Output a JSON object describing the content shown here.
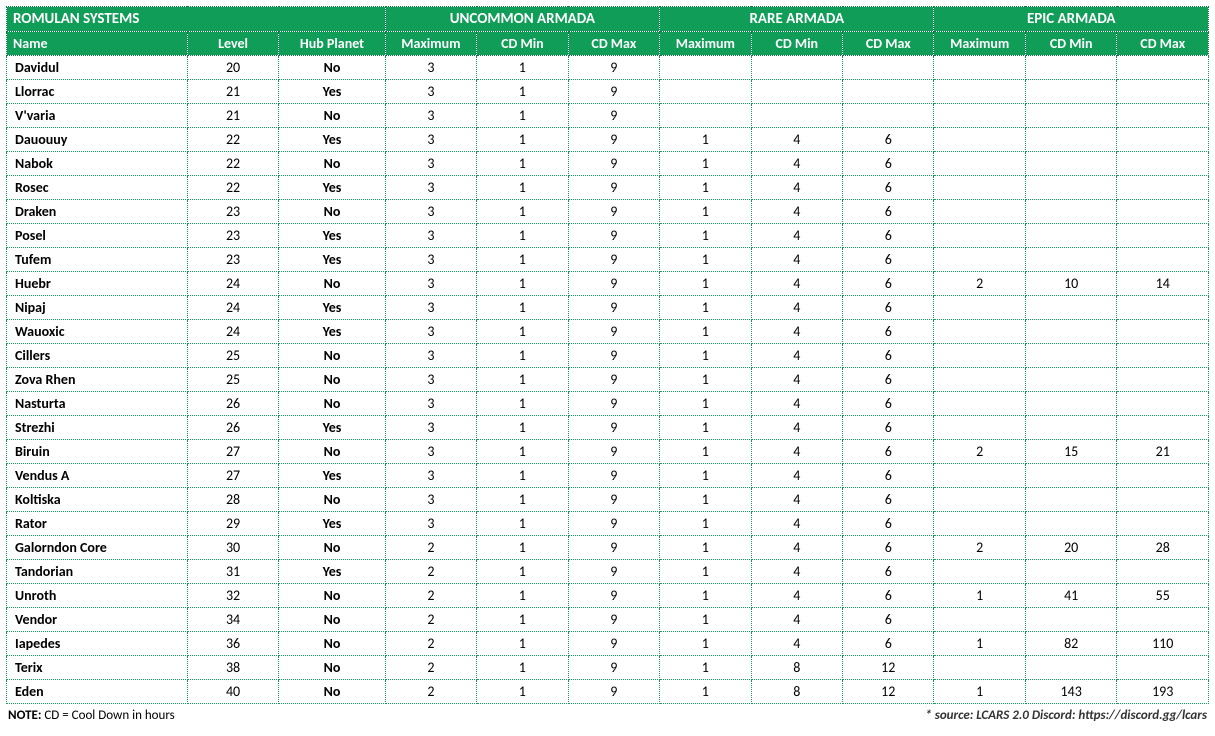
{
  "header": {
    "section_title": "ROMULAN SYSTEMS",
    "groups": [
      "UNCOMMON ARMADA",
      "RARE ARMADA",
      "EPIC ARMADA"
    ],
    "cols": {
      "name": "Name",
      "level": "Level",
      "hub": "Hub Planet",
      "max": "Maximum",
      "cdmin": "CD Min",
      "cdmax": "CD Max"
    }
  },
  "chart_data": {
    "type": "table",
    "title": "ROMULAN SYSTEMS",
    "columns": [
      "Name",
      "Level",
      "Hub Planet",
      "Uncommon Maximum",
      "Uncommon CD Min",
      "Uncommon CD Max",
      "Rare Maximum",
      "Rare CD Min",
      "Rare CD Max",
      "Epic Maximum",
      "Epic CD Min",
      "Epic CD Max"
    ],
    "rows": [
      {
        "name": "Davidul",
        "level": 20,
        "hub": "No",
        "u_max": 3,
        "u_min": 1,
        "u_cdmax": 9,
        "r_max": "",
        "r_min": "",
        "r_cdmax": "",
        "e_max": "",
        "e_min": "",
        "e_cdmax": ""
      },
      {
        "name": "Llorrac",
        "level": 21,
        "hub": "Yes",
        "u_max": 3,
        "u_min": 1,
        "u_cdmax": 9,
        "r_max": "",
        "r_min": "",
        "r_cdmax": "",
        "e_max": "",
        "e_min": "",
        "e_cdmax": ""
      },
      {
        "name": "V'varia",
        "level": 21,
        "hub": "No",
        "u_max": 3,
        "u_min": 1,
        "u_cdmax": 9,
        "r_max": "",
        "r_min": "",
        "r_cdmax": "",
        "e_max": "",
        "e_min": "",
        "e_cdmax": ""
      },
      {
        "name": "Dauouuy",
        "level": 22,
        "hub": "Yes",
        "u_max": 3,
        "u_min": 1,
        "u_cdmax": 9,
        "r_max": 1,
        "r_min": 4,
        "r_cdmax": 6,
        "e_max": "",
        "e_min": "",
        "e_cdmax": ""
      },
      {
        "name": "Nabok",
        "level": 22,
        "hub": "No",
        "u_max": 3,
        "u_min": 1,
        "u_cdmax": 9,
        "r_max": 1,
        "r_min": 4,
        "r_cdmax": 6,
        "e_max": "",
        "e_min": "",
        "e_cdmax": ""
      },
      {
        "name": "Rosec",
        "level": 22,
        "hub": "Yes",
        "u_max": 3,
        "u_min": 1,
        "u_cdmax": 9,
        "r_max": 1,
        "r_min": 4,
        "r_cdmax": 6,
        "e_max": "",
        "e_min": "",
        "e_cdmax": ""
      },
      {
        "name": "Draken",
        "level": 23,
        "hub": "No",
        "u_max": 3,
        "u_min": 1,
        "u_cdmax": 9,
        "r_max": 1,
        "r_min": 4,
        "r_cdmax": 6,
        "e_max": "",
        "e_min": "",
        "e_cdmax": ""
      },
      {
        "name": "Posel",
        "level": 23,
        "hub": "Yes",
        "u_max": 3,
        "u_min": 1,
        "u_cdmax": 9,
        "r_max": 1,
        "r_min": 4,
        "r_cdmax": 6,
        "e_max": "",
        "e_min": "",
        "e_cdmax": ""
      },
      {
        "name": "Tufem",
        "level": 23,
        "hub": "Yes",
        "u_max": 3,
        "u_min": 1,
        "u_cdmax": 9,
        "r_max": 1,
        "r_min": 4,
        "r_cdmax": 6,
        "e_max": "",
        "e_min": "",
        "e_cdmax": ""
      },
      {
        "name": "Huebr",
        "level": 24,
        "hub": "No",
        "u_max": 3,
        "u_min": 1,
        "u_cdmax": 9,
        "r_max": 1,
        "r_min": 4,
        "r_cdmax": 6,
        "e_max": 2,
        "e_min": 10,
        "e_cdmax": 14
      },
      {
        "name": "Nipaj",
        "level": 24,
        "hub": "Yes",
        "u_max": 3,
        "u_min": 1,
        "u_cdmax": 9,
        "r_max": 1,
        "r_min": 4,
        "r_cdmax": 6,
        "e_max": "",
        "e_min": "",
        "e_cdmax": ""
      },
      {
        "name": "Wauoxic",
        "level": 24,
        "hub": "Yes",
        "u_max": 3,
        "u_min": 1,
        "u_cdmax": 9,
        "r_max": 1,
        "r_min": 4,
        "r_cdmax": 6,
        "e_max": "",
        "e_min": "",
        "e_cdmax": ""
      },
      {
        "name": "Cillers",
        "level": 25,
        "hub": "No",
        "u_max": 3,
        "u_min": 1,
        "u_cdmax": 9,
        "r_max": 1,
        "r_min": 4,
        "r_cdmax": 6,
        "e_max": "",
        "e_min": "",
        "e_cdmax": ""
      },
      {
        "name": "Zova Rhen",
        "level": 25,
        "hub": "No",
        "u_max": 3,
        "u_min": 1,
        "u_cdmax": 9,
        "r_max": 1,
        "r_min": 4,
        "r_cdmax": 6,
        "e_max": "",
        "e_min": "",
        "e_cdmax": ""
      },
      {
        "name": "Nasturta",
        "level": 26,
        "hub": "No",
        "u_max": 3,
        "u_min": 1,
        "u_cdmax": 9,
        "r_max": 1,
        "r_min": 4,
        "r_cdmax": 6,
        "e_max": "",
        "e_min": "",
        "e_cdmax": ""
      },
      {
        "name": "Strezhi",
        "level": 26,
        "hub": "Yes",
        "u_max": 3,
        "u_min": 1,
        "u_cdmax": 9,
        "r_max": 1,
        "r_min": 4,
        "r_cdmax": 6,
        "e_max": "",
        "e_min": "",
        "e_cdmax": ""
      },
      {
        "name": "Biruin",
        "level": 27,
        "hub": "No",
        "u_max": 3,
        "u_min": 1,
        "u_cdmax": 9,
        "r_max": 1,
        "r_min": 4,
        "r_cdmax": 6,
        "e_max": 2,
        "e_min": 15,
        "e_cdmax": 21
      },
      {
        "name": "Vendus A",
        "level": 27,
        "hub": "Yes",
        "u_max": 3,
        "u_min": 1,
        "u_cdmax": 9,
        "r_max": 1,
        "r_min": 4,
        "r_cdmax": 6,
        "e_max": "",
        "e_min": "",
        "e_cdmax": ""
      },
      {
        "name": "Koltiska",
        "level": 28,
        "hub": "No",
        "u_max": 3,
        "u_min": 1,
        "u_cdmax": 9,
        "r_max": 1,
        "r_min": 4,
        "r_cdmax": 6,
        "e_max": "",
        "e_min": "",
        "e_cdmax": ""
      },
      {
        "name": "Rator",
        "level": 29,
        "hub": "Yes",
        "u_max": 3,
        "u_min": 1,
        "u_cdmax": 9,
        "r_max": 1,
        "r_min": 4,
        "r_cdmax": 6,
        "e_max": "",
        "e_min": "",
        "e_cdmax": ""
      },
      {
        "name": "Galorndon Core",
        "level": 30,
        "hub": "No",
        "u_max": 2,
        "u_min": 1,
        "u_cdmax": 9,
        "r_max": 1,
        "r_min": 4,
        "r_cdmax": 6,
        "e_max": 2,
        "e_min": 20,
        "e_cdmax": 28
      },
      {
        "name": "Tandorian",
        "level": 31,
        "hub": "Yes",
        "u_max": 2,
        "u_min": 1,
        "u_cdmax": 9,
        "r_max": 1,
        "r_min": 4,
        "r_cdmax": 6,
        "e_max": "",
        "e_min": "",
        "e_cdmax": ""
      },
      {
        "name": "Unroth",
        "level": 32,
        "hub": "No",
        "u_max": 2,
        "u_min": 1,
        "u_cdmax": 9,
        "r_max": 1,
        "r_min": 4,
        "r_cdmax": 6,
        "e_max": 1,
        "e_min": 41,
        "e_cdmax": 55
      },
      {
        "name": "Vendor",
        "level": 34,
        "hub": "No",
        "u_max": 2,
        "u_min": 1,
        "u_cdmax": 9,
        "r_max": 1,
        "r_min": 4,
        "r_cdmax": 6,
        "e_max": "",
        "e_min": "",
        "e_cdmax": ""
      },
      {
        "name": "Iapedes",
        "level": 36,
        "hub": "No",
        "u_max": 2,
        "u_min": 1,
        "u_cdmax": 9,
        "r_max": 1,
        "r_min": 4,
        "r_cdmax": 6,
        "e_max": 1,
        "e_min": 82,
        "e_cdmax": 110
      },
      {
        "name": "Terix",
        "level": 38,
        "hub": "No",
        "u_max": 2,
        "u_min": 1,
        "u_cdmax": 9,
        "r_max": 1,
        "r_min": 8,
        "r_cdmax": 12,
        "e_max": "",
        "e_min": "",
        "e_cdmax": ""
      },
      {
        "name": "Eden",
        "level": 40,
        "hub": "No",
        "u_max": 2,
        "u_min": 1,
        "u_cdmax": 9,
        "r_max": 1,
        "r_min": 8,
        "r_cdmax": 12,
        "e_max": 1,
        "e_min": 143,
        "e_cdmax": 193
      }
    ]
  },
  "footer": {
    "note_label": "NOTE:",
    "note_text": " CD = Cool Down in hours",
    "source": "* source: LCARS 2.0 Discord: https://discord.gg/lcars"
  }
}
